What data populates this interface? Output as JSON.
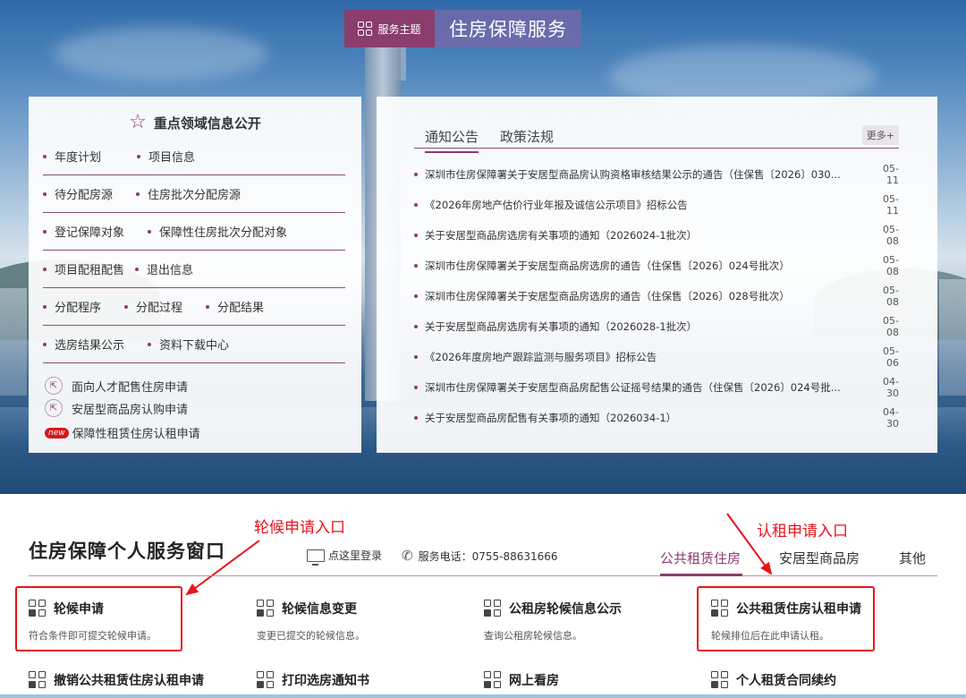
{
  "banner": {
    "tag_label": "服务主题",
    "title": "住房保障服务"
  },
  "left_panel": {
    "heading": "重点领域信息公开",
    "rows": [
      [
        "年度计划",
        "项目信息"
      ],
      [
        "待分配房源",
        "住房批次分配房源"
      ],
      [
        "登记保障对象",
        "保障性住房批次分配对象"
      ],
      [
        "项目配租配售",
        "退出信息"
      ],
      [
        "分配程序",
        "分配过程",
        "分配结果"
      ],
      [
        "选房结果公示",
        "资料下载中心"
      ]
    ],
    "applications": [
      {
        "label": "面向人才配售住房申请",
        "icon": "apply-icon"
      },
      {
        "label": "安居型商品房认购申请",
        "icon": "apply-icon"
      },
      {
        "label": "保障性租赁住房认租申请",
        "icon": "new-badge",
        "badge": "new"
      }
    ]
  },
  "right_panel": {
    "tabs": [
      "通知公告",
      "政策法规"
    ],
    "more_label": "更多+",
    "news": [
      {
        "title": "深圳市住房保障署关于安居型商品房认购资格审核结果公示的通告（住保售〔2026〕030...",
        "date": "05-11"
      },
      {
        "title": "《2026年房地产估价行业年报及诚信公示项目》招标公告",
        "date": "05-11"
      },
      {
        "title": "关于安居型商品房选房有关事项的通知（2026024-1批次）",
        "date": "05-08"
      },
      {
        "title": "深圳市住房保障署关于安居型商品房选房的通告（住保售〔2026〕024号批次）",
        "date": "05-08"
      },
      {
        "title": "深圳市住房保障署关于安居型商品房选房的通告（住保售〔2026〕028号批次）",
        "date": "05-08"
      },
      {
        "title": "关于安居型商品房选房有关事项的通知（2026028-1批次）",
        "date": "05-08"
      },
      {
        "title": "《2026年度房地产跟踪监测与服务项目》招标公告",
        "date": "05-06"
      },
      {
        "title": "深圳市住房保障署关于安居型商品房配售公证摇号结果的通告（住保售〔2026〕024号批...",
        "date": "04-30"
      },
      {
        "title": "关于安居型商品房配售有关事项的通知（2026034-1）",
        "date": "04-30"
      }
    ]
  },
  "service": {
    "title": "住房保障个人服务窗口",
    "login_label": "点这里登录",
    "phone_label": "服务电话：0755-88631666",
    "tabs": [
      "公共租赁住房",
      "安居型商品房",
      "其他"
    ],
    "cards": [
      {
        "title": "轮候申请",
        "desc": "符合条件即可提交轮候申请。"
      },
      {
        "title": "轮候信息变更",
        "desc": "变更已提交的轮候信息。"
      },
      {
        "title": "公租房轮候信息公示",
        "desc": "查询公租房轮候信息。"
      },
      {
        "title": "公共租赁住房认租申请",
        "desc": "轮候排位后在此申请认租。"
      },
      {
        "title": "撤销公共租赁住房认租申请",
        "desc": ""
      },
      {
        "title": "打印选房通知书",
        "desc": ""
      },
      {
        "title": "网上看房",
        "desc": ""
      },
      {
        "title": "个人租赁合同续约",
        "desc": ""
      }
    ]
  },
  "annotations": {
    "left_label": "轮候申请入口",
    "right_label": "认租申请入口",
    "color": "#e8131b"
  },
  "colors": {
    "accent": "#8a3d6e",
    "banner_title_bg": "#7868aa"
  }
}
